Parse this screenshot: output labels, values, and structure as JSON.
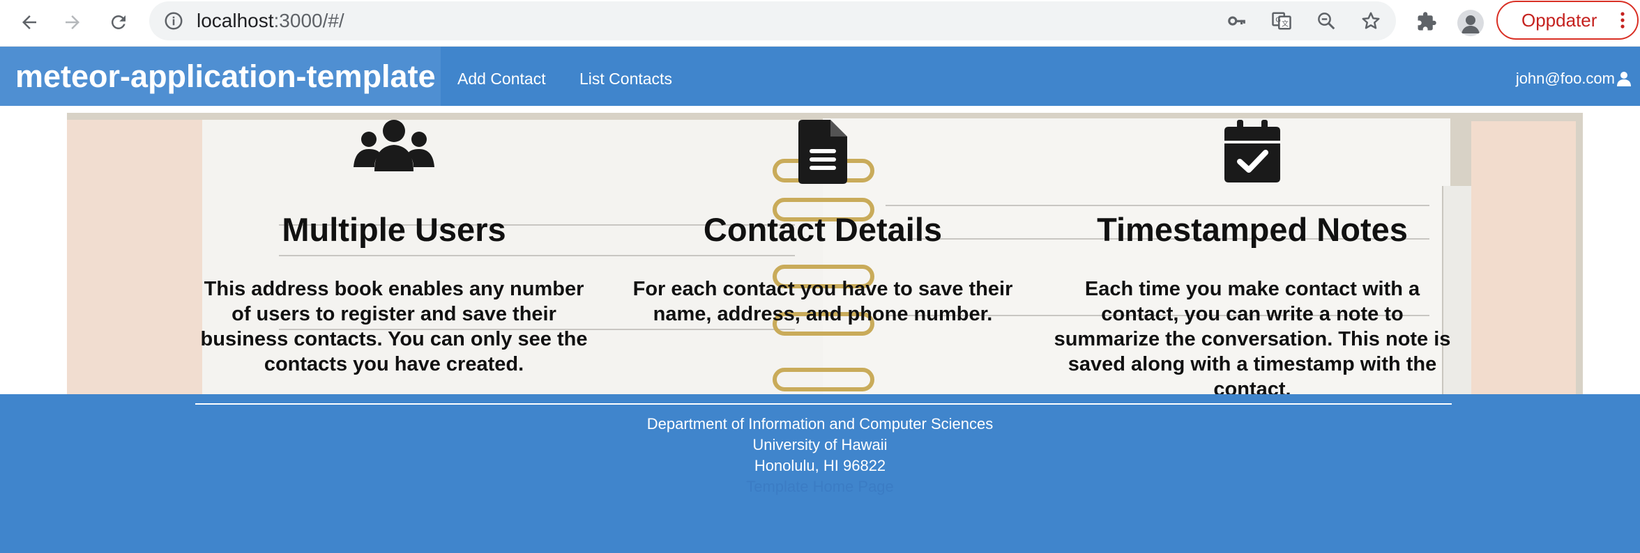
{
  "browser": {
    "url_host": "localhost",
    "url_path": ":3000/#/",
    "update_label": "Oppdater"
  },
  "navbar": {
    "brand": "meteor-application-template",
    "links": [
      "Add Contact",
      "List Contacts"
    ],
    "user": "john@foo.com"
  },
  "features": [
    {
      "icon": "users-icon",
      "title": "Multiple Users",
      "text": "This address book enables any number of users to register and save their business contacts. You can only see the contacts you have created."
    },
    {
      "icon": "file-icon",
      "title": "Contact Details",
      "text": "For each contact you have to save their name, address, and phone number."
    },
    {
      "icon": "calendar-check-icon",
      "title": "Timestamped Notes",
      "text": "Each time you make contact with a contact, you can write a note to summarize the conversation. This note is saved along with a timestamp with the contact."
    }
  ],
  "footer": {
    "lines": [
      "Department of Information and Computer Sciences",
      "University of Hawaii",
      "Honolulu, HI 96822"
    ],
    "link": "Template Home Page"
  },
  "colors": {
    "navbar": "#4085cc",
    "update_button": "#d93025"
  }
}
